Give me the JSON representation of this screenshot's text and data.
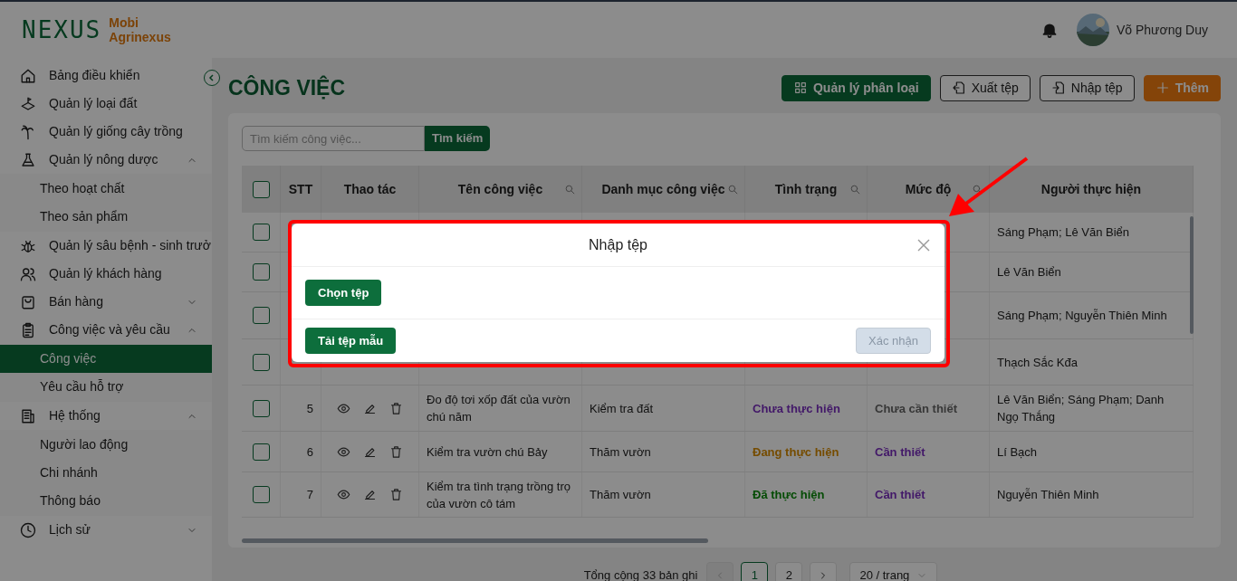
{
  "brand": {
    "logo": "NEXUS",
    "name_line1": "Mobi",
    "name_line2": "Agrinexus"
  },
  "user": {
    "name": "Võ Phương Duy"
  },
  "sidebar": {
    "items": [
      {
        "label": "Bảng điều khiển"
      },
      {
        "label": "Quản lý loại đất"
      },
      {
        "label": "Quản lý giống cây trồng"
      },
      {
        "label": "Quản lý nông dược",
        "expanded": true,
        "children": [
          {
            "label": "Theo hoạt chất",
            "selected": false
          },
          {
            "label": "Theo sản phẩm",
            "selected": false
          }
        ]
      },
      {
        "label": "Quản lý sâu bệnh - sinh trưở"
      },
      {
        "label": "Quản lý khách hàng"
      },
      {
        "label": "Bán hàng",
        "expanded": false
      },
      {
        "label": "Công việc và yêu cầu",
        "expanded": true,
        "children": [
          {
            "label": "Công việc",
            "selected": true
          },
          {
            "label": "Yêu cầu hỗ trợ",
            "selected": false
          }
        ]
      },
      {
        "label": "Hệ thống",
        "expanded": true,
        "children": [
          {
            "label": "Người lao động",
            "selected": false
          },
          {
            "label": "Chi nhánh",
            "selected": false
          },
          {
            "label": "Thông báo",
            "selected": false
          }
        ]
      },
      {
        "label": "Lịch sử",
        "expanded": false
      }
    ]
  },
  "page": {
    "title": "CÔNG VIỆC"
  },
  "actions": [
    {
      "label": "Quản lý phân loại",
      "kind": "primary"
    },
    {
      "label": "Xuất tệp",
      "kind": "export"
    },
    {
      "label": "Nhập tệp",
      "kind": "import"
    },
    {
      "label": "Thêm",
      "kind": "add"
    }
  ],
  "search": {
    "placeholder": "Tìm kiếm công việc...",
    "button": "Tìm kiếm"
  },
  "table": {
    "columns": [
      {
        "kind": "check",
        "checked": false
      },
      {
        "label": "STT",
        "filter": false
      },
      {
        "label": "Thao tác",
        "filter": false
      },
      {
        "label": "Tên công việc",
        "filter": true
      },
      {
        "label": "Danh mục công việc",
        "filter": true
      },
      {
        "label": "Tình trạng",
        "filter": true
      },
      {
        "label": "Mức độ",
        "filter": true
      },
      {
        "label": "Người thực hiện",
        "filter": false
      }
    ],
    "rows": [
      {
        "checked": false,
        "assignees": "Sáng Phạm; Lê  Văn Biển"
      },
      {
        "checked": false,
        "assignees": "Lê  Văn Biển"
      },
      {
        "checked": false,
        "assignees": "Sáng Phạm; Nguyễn  Thiên Minh"
      },
      {
        "checked": false,
        "assignees": "Thạch Sắc Kđa"
      },
      {
        "checked": false,
        "stt": "5",
        "name": "Đo độ tơi xốp đất của vườn chú năm",
        "category": "Kiểm tra đất",
        "status": {
          "label": "Chưa thực hiện",
          "kind": "todo"
        },
        "priority": {
          "label": "Chưa cần thiết",
          "kind": "low"
        },
        "assignees": "Lê  Văn Biển; Sáng Phạm; Danh  Ngọ Thắng"
      },
      {
        "checked": false,
        "stt": "6",
        "name": "Kiểm tra vườn chú Bảy",
        "category": "Thăm vườn",
        "status": {
          "label": "Đang thực hiện",
          "kind": "doing"
        },
        "priority": {
          "label": "Cần thiết",
          "kind": "high"
        },
        "assignees": "Lí  Bạch"
      },
      {
        "checked": false,
        "stt": "7",
        "name": "Kiểm tra tình trạng trồng trọ của vườn cô tám",
        "category": "Thăm vườn",
        "status": {
          "label": "Đã thực hiện",
          "kind": "done"
        },
        "priority": {
          "label": "Cần thiết",
          "kind": "high"
        },
        "assignees": "Nguyễn  Thiên Minh"
      }
    ]
  },
  "pagination": {
    "total": "Tổng cộng 33 bản ghi",
    "pages": [
      {
        "label": "1",
        "selected": true
      },
      {
        "label": "2",
        "selected": false
      }
    ],
    "page_size": "20 / trang"
  },
  "modal": {
    "title": "Nhập tệp",
    "choose": "Chọn tệp",
    "template": "Tải tệp mẫu",
    "confirm": "Xác nhận",
    "confirm_disabled": true
  }
}
